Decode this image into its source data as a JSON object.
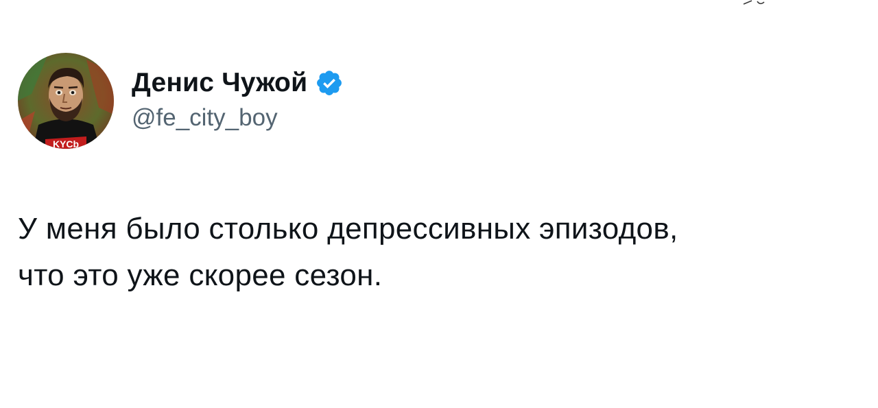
{
  "author": {
    "display_name": "Денис Чужой",
    "handle": "@fe_city_boy",
    "verified": true,
    "avatar_shirt_text": "KYCb",
    "avatar_icon": "user-avatar-icon",
    "verified_icon": "verified-badge-icon"
  },
  "tweet": {
    "lines": [
      "У меня было столько депрессивных эпизодов,",
      "что это уже скорее сезон."
    ]
  },
  "colors": {
    "text_primary": "#0f1419",
    "text_secondary": "#536471",
    "verified_blue": "#1d9bf0",
    "background": "#ffffff"
  }
}
